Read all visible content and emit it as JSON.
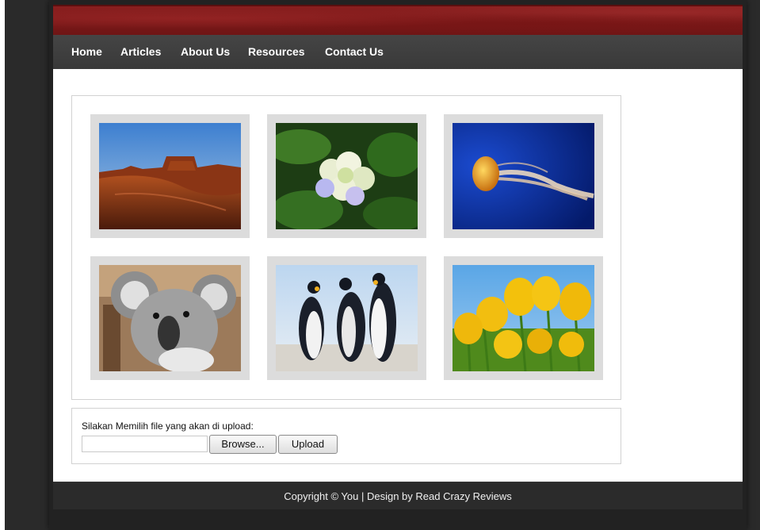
{
  "nav": {
    "items": [
      {
        "label": "Home"
      },
      {
        "label": "Articles"
      },
      {
        "label": "About Us"
      },
      {
        "label": "Resources"
      },
      {
        "label": "Contact Us"
      }
    ]
  },
  "gallery": {
    "images": [
      {
        "subject": "desert-butte"
      },
      {
        "subject": "hydrangea"
      },
      {
        "subject": "jellyfish"
      },
      {
        "subject": "koala"
      },
      {
        "subject": "penguins"
      },
      {
        "subject": "tulips"
      }
    ]
  },
  "upload": {
    "label": "Silakan Memilih file yang akan di upload:",
    "file_value": "",
    "browse_label": "Browse...",
    "upload_label": "Upload"
  },
  "footer": {
    "text": "Copyright © You | Design by Read Crazy Reviews"
  },
  "colors": {
    "banner": "#7a1a1a",
    "nav": "#404040",
    "footer": "#2b2b2b",
    "background": "#2a2a2a"
  }
}
